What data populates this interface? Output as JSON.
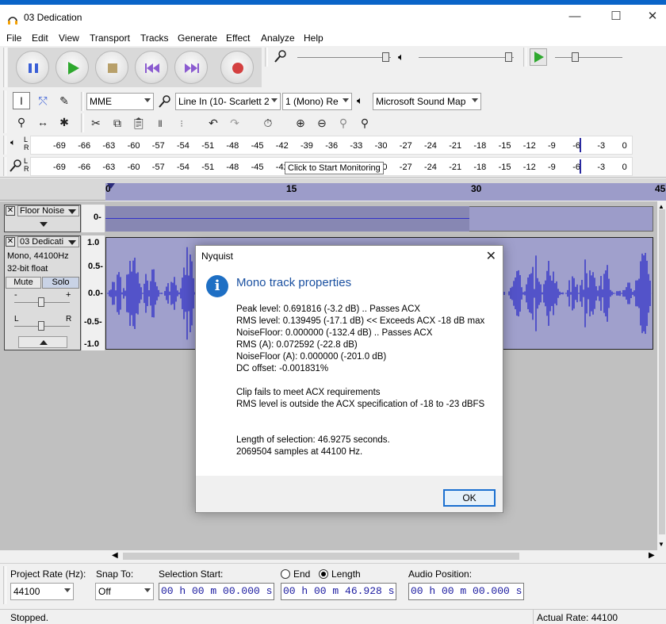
{
  "window": {
    "title": "03 Dedication",
    "minimize": "—",
    "maximize": "☐",
    "close": "✕"
  },
  "menu": [
    "File",
    "Edit",
    "View",
    "Transport",
    "Tracks",
    "Generate",
    "Effect",
    "Analyze",
    "Help"
  ],
  "transport": {
    "pause_icon": "pause-icon",
    "play_icon": "play-icon",
    "stop_icon": "stop-icon",
    "skip_start_icon": "skip-start-icon",
    "skip_end_icon": "skip-end-icon",
    "record_icon": "record-icon"
  },
  "device": {
    "host": "MME",
    "input": "Line In (10- Scarlett 2",
    "channels": "1 (Mono) Re",
    "output": "Microsoft Sound Map"
  },
  "meter_ticks": [
    "-69",
    "-66",
    "-63",
    "-60",
    "-57",
    "-54",
    "-51",
    "-48",
    "-45",
    "-42",
    "-39",
    "-36",
    "-33",
    "-30",
    "-27",
    "-24",
    "-21",
    "-18",
    "-15",
    "-12",
    "-9",
    "-6",
    "-3",
    "0"
  ],
  "meter_tooltip": "Click to Start Monitoring",
  "meter_labels": {
    "play_L": "L",
    "play_R": "R",
    "rec_L": "L",
    "rec_R": "R"
  },
  "ruler": {
    "marks": [
      "0",
      "15",
      "30",
      "45"
    ]
  },
  "tracks": {
    "floor": {
      "name": "Floor Noise",
      "scale": "0-"
    },
    "voice": {
      "name": "03 Dedicati",
      "info1": "Mono, 44100Hz",
      "info2": "32-bit float",
      "mute": "Mute",
      "solo": "Solo",
      "gain_minus": "-",
      "gain_plus": "+",
      "pan_l": "L",
      "pan_r": "R",
      "scale": [
        "1.0",
        "0.5-",
        "0.0-",
        "-0.5-",
        "-1.0"
      ]
    }
  },
  "dialog": {
    "title": "Nyquist",
    "heading": "Mono track properties",
    "lines": [
      "Peak level: 0.691816 (-3.2 dB)  .. Passes ACX",
      "RMS level: 0.139495 (-17.1 dB)  << Exceeds ACX -18 dB max",
      "NoiseFloor: 0.000000 (-132.4 dB)  .. Passes ACX",
      "RMS (A): 0.072592 (-22.8 dB)",
      "NoiseFloor (A): 0.000000 (-201.0 dB)",
      "DC offset: -0.001831%",
      "",
      "Clip fails to meet ACX requirements",
      "RMS level is outside the ACX specification of -18 to -23 dBFS",
      "",
      "",
      "Length of selection: 46.9275 seconds.",
      "2069504 samples at 44100 Hz."
    ],
    "ok": "OK"
  },
  "selection_toolbar": {
    "project_rate_label": "Project Rate (Hz):",
    "project_rate": "44100",
    "snap_label": "Snap To:",
    "snap": "Off",
    "sel_start_label": "Selection Start:",
    "end_label": "End",
    "length_label": "Length",
    "audio_pos_label": "Audio Position:",
    "sel_start": "00 h 00 m 00.000 s",
    "length": "00 h 00 m 46.928 s",
    "audio_pos": "00 h 00 m 00.000 s"
  },
  "status": {
    "left": "Stopped.",
    "right": "Actual Rate: 44100"
  },
  "colors": {
    "accent": "#1a6fd0",
    "waveform": "#3232c8",
    "selection": "#9c9cc9"
  }
}
